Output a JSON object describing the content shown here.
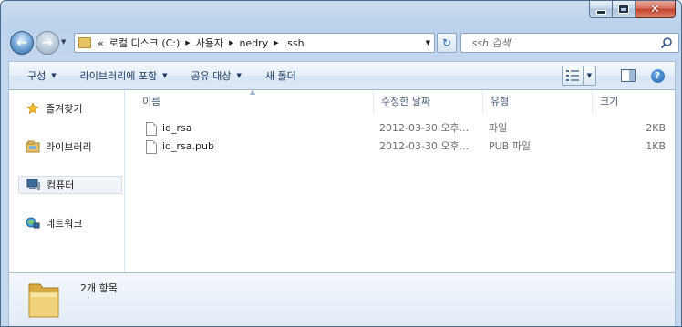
{
  "window": {
    "caption": {
      "minimize": "minimize",
      "maximize": "maximize",
      "close": "✕"
    }
  },
  "nav": {
    "back_glyph": "←",
    "forward_glyph": "→",
    "refresh_glyph": "↻",
    "breadcrumb": {
      "overflow": "«",
      "items": [
        "로컬 디스크 (C:)",
        "사용자",
        "nedry",
        ".ssh"
      ]
    },
    "search_placeholder": ".ssh 검색"
  },
  "cmdbar": {
    "organize": "구성",
    "include_library": "라이브러리에 포함",
    "share_with": "공유 대상",
    "new_folder": "새 폴더",
    "help": "?"
  },
  "navpane": {
    "items": [
      {
        "label": "즐겨찾기",
        "icon": "star-icon"
      },
      {
        "label": "라이브러리",
        "icon": "library-icon"
      },
      {
        "label": "컴퓨터",
        "icon": "computer-icon"
      },
      {
        "label": "네트워크",
        "icon": "network-icon"
      }
    ]
  },
  "columns": {
    "name": "이름",
    "date": "수정한 날짜",
    "type": "유형",
    "size": "크기"
  },
  "files": [
    {
      "name": "id_rsa",
      "date": "2012-03-30 오후...",
      "type": "파일",
      "size": "2KB"
    },
    {
      "name": "id_rsa.pub",
      "date": "2012-03-30 오후...",
      "type": "PUB 파일",
      "size": "1KB"
    }
  ],
  "details": {
    "item_count": "2개 항목"
  },
  "colors": {
    "chrome": "#b9d1ea",
    "accent": "#2d6fb3",
    "close_button": "#c4422a",
    "folder": "#e8c467"
  }
}
